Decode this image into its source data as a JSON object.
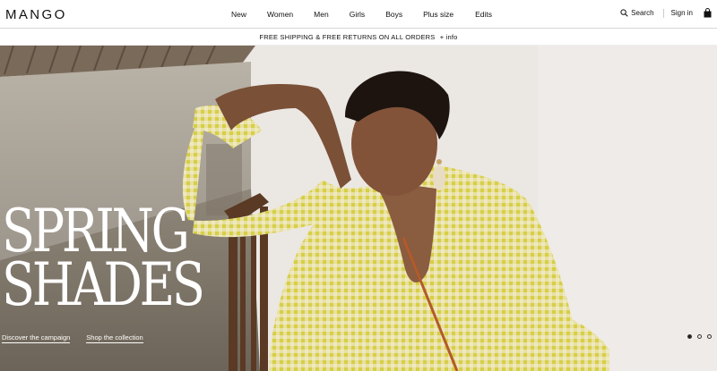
{
  "header": {
    "logo": "MANGO",
    "nav": [
      {
        "label": "New"
      },
      {
        "label": "Women"
      },
      {
        "label": "Men"
      },
      {
        "label": "Girls"
      },
      {
        "label": "Boys"
      },
      {
        "label": "Plus size"
      },
      {
        "label": "Edits"
      }
    ],
    "search_label": "Search",
    "signin_label": "Sign in"
  },
  "promo": {
    "text": "FREE SHIPPING & FREE RETURNS ON ALL ORDERS",
    "info": "+ info"
  },
  "hero": {
    "headline_line1": "SPRING",
    "headline_line2": "SHADES",
    "cta_campaign": "Discover the campaign",
    "cta_collection": "Shop the collection",
    "slides_count": 3,
    "active_slide": 1
  },
  "colors": {
    "shirt": "#e6dc8a",
    "check": "#c9c23a",
    "wall": "#ebe8e4",
    "skin": "#7a5037"
  },
  "icons": [
    "search-icon",
    "shopping-bag-icon"
  ]
}
